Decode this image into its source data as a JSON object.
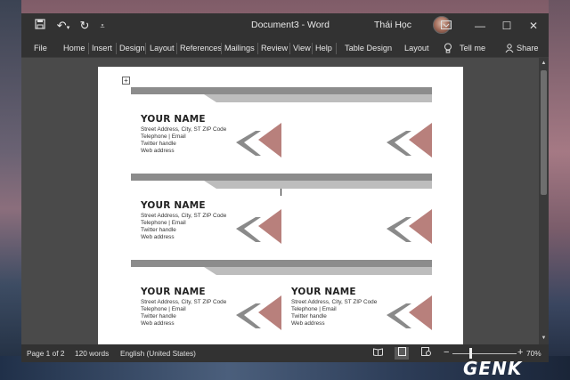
{
  "window": {
    "doc_title": "Document3  -  Word",
    "user_name": "Thái Học"
  },
  "titlebar_icons": {
    "save": "save-icon",
    "undo": "undo-icon",
    "redo": "redo-icon",
    "customize": "customize-qat-icon"
  },
  "tabs": [
    {
      "label": "File"
    },
    {
      "label": "Home"
    },
    {
      "label": "Insert"
    },
    {
      "label": "Design"
    },
    {
      "label": "Layout"
    },
    {
      "label": "References"
    },
    {
      "label": "Mailings"
    },
    {
      "label": "Review"
    },
    {
      "label": "View"
    },
    {
      "label": "Help"
    },
    {
      "label": "Table Design"
    },
    {
      "label": "Layout"
    }
  ],
  "tell_me": "Tell me",
  "share": "Share",
  "cards": [
    {
      "name": "YOUR NAME",
      "address": "Street Address, City, ST ZIP Code",
      "phone": "Telephone | Email",
      "twitter": "Twitter handle",
      "web": "Web address"
    },
    {
      "name": "",
      "address": "",
      "phone": "",
      "twitter": "",
      "web": ""
    },
    {
      "name": "YOUR NAME",
      "address": "Street Address, City, ST ZIP Code",
      "phone": "Telephone | Email",
      "twitter": "Twitter handle",
      "web": "Web address"
    },
    {
      "name": "",
      "address": "",
      "phone": "",
      "twitter": "",
      "web": ""
    },
    {
      "name": "YOUR NAME",
      "address": "Street Address, City, ST ZIP Code",
      "phone": "Telephone | Email",
      "twitter": "Twitter handle",
      "web": "Web address"
    },
    {
      "name": "YOUR NAME",
      "address": "Street Address, City, ST ZIP Code",
      "phone": "Telephone | Email",
      "twitter": "Twitter handle",
      "web": "Web address"
    }
  ],
  "colors": {
    "accent_rose": "#b8807c",
    "band_gray": "#8c8c8c",
    "band_light": "#bdbdbd",
    "chevron_gray": "#8a8a8a"
  },
  "status": {
    "page": "Page 1 of 2",
    "words": "120 words",
    "language": "English (United States)",
    "zoom": "70%"
  },
  "watermark": "GENK"
}
